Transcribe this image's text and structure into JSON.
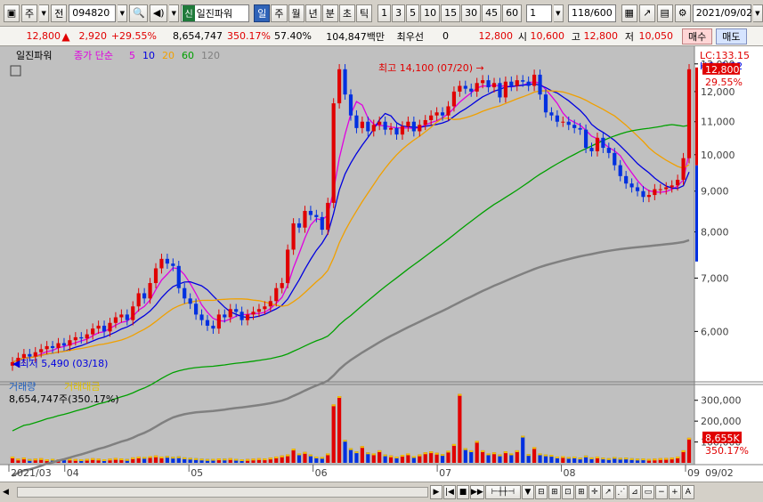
{
  "toolbar": {
    "menu_icon": "window-icon",
    "market_mode": "주",
    "prev_label": "전",
    "stock_code": "094820",
    "search_icon": "search-icon",
    "sound_icon": "speaker-icon",
    "sin_badge": "신",
    "stock_name": "일진파워",
    "period_tabs": [
      "일",
      "주",
      "월",
      "년",
      "분",
      "초",
      "틱"
    ],
    "active_period": "일",
    "intervals": [
      "1",
      "3",
      "5",
      "10",
      "15",
      "30",
      "45",
      "60"
    ],
    "interval_value": "1",
    "count_value": "118",
    "count_max": "/600",
    "date_value": "2021/09/02"
  },
  "infobar": {
    "price": "12,800",
    "change": "2,920",
    "change_pct": "+29.55%",
    "volume": "8,654,747",
    "vol_ratio": "350.17%",
    "turnover_pct": "57.40%",
    "amount": "104,847백만",
    "min_label": "최우선",
    "min_value": "0",
    "price2": "12,800",
    "open_label": "시",
    "open": "10,600",
    "high_label": "고",
    "high": "12,800",
    "low_label": "저",
    "low": "10,050",
    "buy_label": "매수",
    "sell_label": "매도"
  },
  "chart_labels": {
    "stock_name": "일진파워",
    "ma_title": "종가 단순",
    "ma_periods": [
      "5",
      "10",
      "20",
      "60",
      "120"
    ],
    "ma_colors": [
      "#e000e0",
      "#0000e0",
      "#f0a000",
      "#00a000",
      "#808080"
    ],
    "lc": "LC:133.15",
    "hc": "HC:-9.22",
    "high_annot": "최고 14,100 (07/20)",
    "low_annot": "최저 5,490 (03/18)",
    "price_tag": "12,800",
    "pct_tag": "29.55%",
    "vol_title1": "거래량",
    "vol_title2": "거래대금",
    "vol_value": "8,654,747주(350.17%)",
    "vol_tag": "8,655K",
    "vol_pct_tag": "350.17%"
  },
  "chart_data": {
    "type": "candlestick",
    "y_ticks": [
      6000,
      7000,
      8000,
      9000,
      10000,
      11000,
      12000,
      13000
    ],
    "y_tick_labels": [
      "6,000",
      "7,000",
      "8,000",
      "9,000",
      "10,000",
      "11,000",
      "12,000",
      "13,000"
    ],
    "vol_ticks": [
      100000,
      200000,
      300000
    ],
    "vol_tick_labels": [
      "100,000",
      "200,000",
      "300,000"
    ],
    "x_labels": [
      "2021/03",
      "04",
      "05",
      "06",
      "07",
      "08",
      "09"
    ],
    "last_date": "09/02",
    "price_series": {
      "close": [
        5490,
        5560,
        5620,
        5580,
        5650,
        5700,
        5750,
        5720,
        5800,
        5760,
        5850,
        5900,
        5880,
        5950,
        6050,
        6100,
        6000,
        6150,
        6250,
        6300,
        6200,
        6450,
        6700,
        6600,
        6900,
        7200,
        7400,
        7300,
        7250,
        6800,
        6600,
        6500,
        6300,
        6200,
        6100,
        6050,
        6300,
        6250,
        6400,
        6350,
        6200,
        6300,
        6350,
        6400,
        6450,
        6550,
        6800,
        6900,
        7600,
        8200,
        8100,
        8500,
        8400,
        8350,
        8050,
        8700,
        11600,
        12800,
        11900,
        11200,
        10800,
        11000,
        10700,
        10900,
        11000,
        10750,
        10800,
        10600,
        10850,
        11000,
        10700,
        10900,
        11050,
        11200,
        11300,
        11200,
        11500,
        12000,
        12200,
        12100,
        12000,
        12300,
        12400,
        12150,
        12300,
        11800,
        12350,
        12200,
        12400,
        12350,
        12200,
        12600,
        11900,
        11300,
        11200,
        11000,
        11000,
        10900,
        10800,
        10750,
        10200,
        10100,
        10500,
        10200,
        10050,
        9700,
        9400,
        9200,
        9100,
        9000,
        8850,
        8900,
        9050,
        9050,
        9100,
        9150,
        9300,
        9900,
        12800
      ],
      "bar_volume": [
        30000,
        20000,
        25000,
        18000,
        20000,
        22000,
        17000,
        19000,
        16000,
        21000,
        20000,
        18000,
        17000,
        19000,
        22000,
        20000,
        17000,
        20000,
        23000,
        21000,
        18000,
        26000,
        30000,
        28000,
        32000,
        35000,
        30000,
        33000,
        29000,
        31000,
        26000,
        24000,
        22000,
        20000,
        18000,
        19000,
        21000,
        20000,
        22000,
        19000,
        17000,
        18000,
        20000,
        22000,
        21000,
        25000,
        30000,
        35000,
        40000,
        68000,
        45000,
        52000,
        40000,
        30000,
        28000,
        45000,
        280000,
        320000,
        110000,
        70000,
        55000,
        80000,
        50000,
        45000,
        60000,
        40000,
        35000,
        30000,
        38000,
        45000,
        32000,
        40000,
        50000,
        55000,
        48000,
        42000,
        58000,
        90000,
        330000,
        70000,
        60000,
        105000,
        60000,
        45000,
        50000,
        40000,
        55000,
        45000,
        60000,
        130000,
        42000,
        75000,
        45000,
        40000,
        38000,
        30000,
        32000,
        28000,
        30000,
        25000,
        35000,
        26000,
        30000,
        25000,
        22000,
        28000,
        24000,
        25000,
        22000,
        20000,
        21000,
        19000,
        20000,
        22000,
        23000,
        25000,
        30000,
        60000,
        120000
      ]
    }
  }
}
